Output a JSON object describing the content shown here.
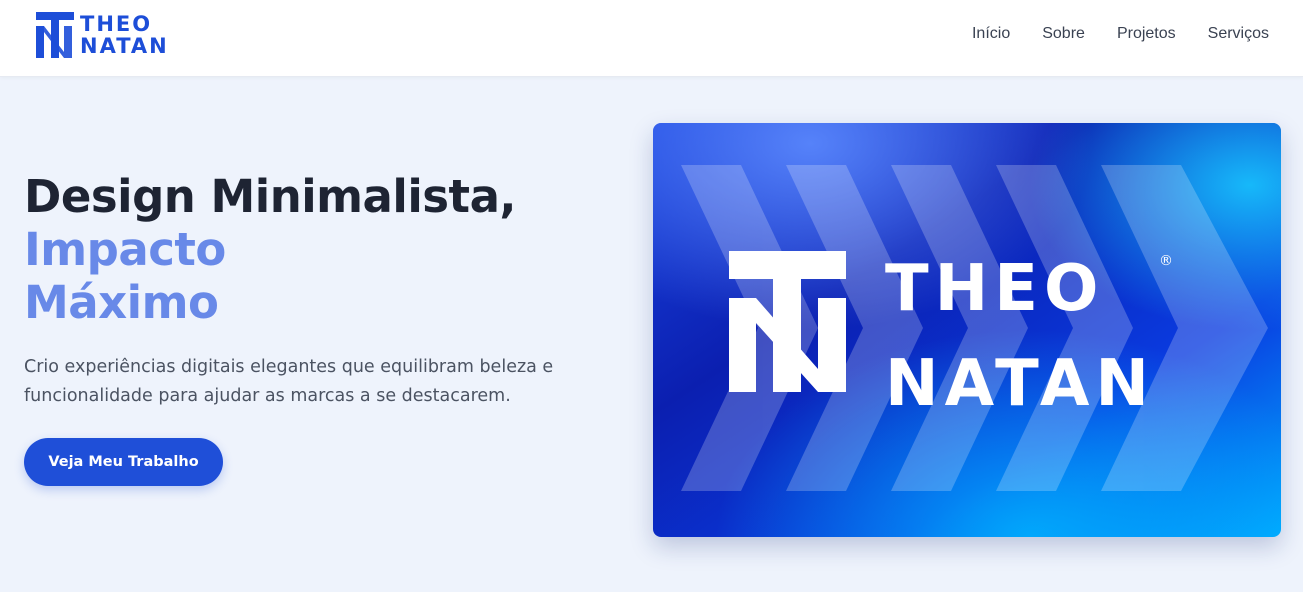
{
  "brand": {
    "name_line1": "THEO",
    "name_line2": "NATAN",
    "color": "#1d4ed8",
    "mark_icon": "tn-monogram-logo"
  },
  "nav": {
    "items": [
      {
        "label": "Início"
      },
      {
        "label": "Sobre"
      },
      {
        "label": "Projetos"
      },
      {
        "label": "Serviços"
      }
    ]
  },
  "hero": {
    "title_line1": "Design Minimalista,",
    "title_line2": "Impacto",
    "title_line3": "Máximo",
    "description": "Crio experiências digitais elegantes que equilibram beleza e funcionalidade para ajudar as marcas a se destacarem.",
    "cta_label": "Veja Meu Trabalho",
    "accent_color": "#6889e8",
    "button_color": "#1f4fd8"
  },
  "hero_image": {
    "name_line1": "THEO",
    "name_line2": "NATAN",
    "registered_mark": "®",
    "background_colors": [
      "#1a3fd6",
      "#0a1fa8",
      "#00a6ff"
    ]
  }
}
